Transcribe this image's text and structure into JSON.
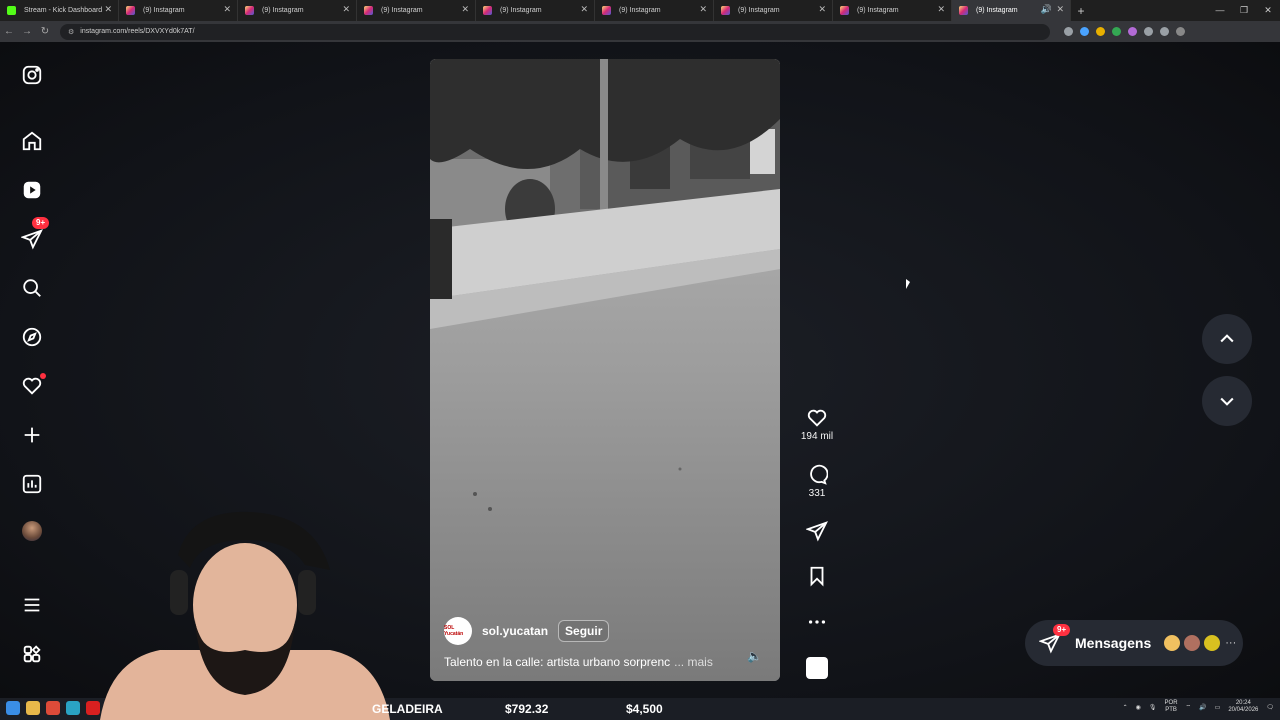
{
  "browser": {
    "tabs": [
      {
        "title": "Stream - Kick Dashboard",
        "icon": "kick-icon"
      },
      {
        "title": "(9) Instagram",
        "icon": "instagram-icon"
      },
      {
        "title": "(9) Instagram",
        "icon": "instagram-icon"
      },
      {
        "title": "(9) Instagram",
        "icon": "instagram-icon"
      },
      {
        "title": "(9) Instagram",
        "icon": "instagram-icon"
      },
      {
        "title": "(9) Instagram",
        "icon": "instagram-icon"
      },
      {
        "title": "(9) Instagram",
        "icon": "instagram-icon"
      },
      {
        "title": "(9) Instagram",
        "icon": "instagram-icon"
      },
      {
        "title": "(9) Instagram",
        "icon": "instagram-icon",
        "active": true
      }
    ],
    "url": "instagram.com/reels/DXVXYd0k7AT/"
  },
  "sidebar": {
    "notifications_badge": "9+"
  },
  "reel": {
    "author": "sol.yucatan",
    "author_logo_text": "SOL Yucatán",
    "follow_label": "Seguir",
    "caption": "Talento en la calle: artista urbano sorprenc",
    "caption_more": "... mais"
  },
  "actions": {
    "likes": "194 mil",
    "comments": "331"
  },
  "messages": {
    "label": "Mensagens",
    "badge": "9+",
    "more": "···"
  },
  "stream_overlay": {
    "item1": "GELADEIRA",
    "item2": "$792.32",
    "item3": "$4,500"
  },
  "taskbar": {
    "lang_top": "POR",
    "lang_bottom": "PTB",
    "time": "20:24",
    "date": "20/04/2026"
  },
  "colors": {
    "notification_red": "#ff3040",
    "page_bg": "#111318",
    "button_bg": "#262a33"
  }
}
